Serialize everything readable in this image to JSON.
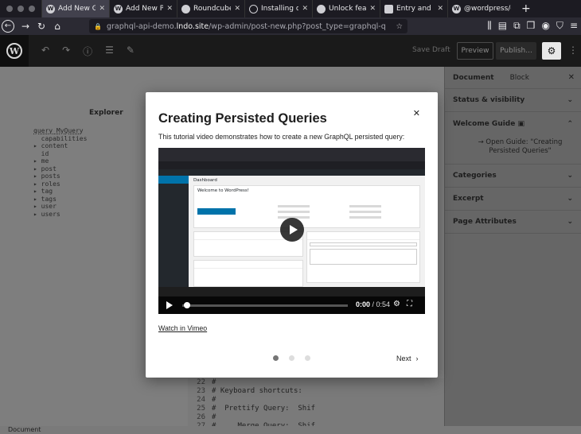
{
  "browser": {
    "tabs": [
      {
        "label": "Add New Graph",
        "icon": "wordpress-icon",
        "active": true
      },
      {
        "label": "Add New Post",
        "icon": "wordpress-icon",
        "active": false
      },
      {
        "label": "Roundcube We",
        "icon": "roundcube-icon",
        "active": false
      },
      {
        "label": "Installing on W",
        "icon": "loading-icon",
        "active": false
      },
      {
        "label": "Unlock feature",
        "icon": "github-icon",
        "active": false
      },
      {
        "label": "Entry and Cont",
        "icon": "page-icon",
        "active": false
      },
      {
        "label": "@wordpress/co",
        "icon": "wordpress-icon",
        "active": false
      }
    ],
    "url_prefix": "graphql-api-demo.",
    "url_domain": "lndo.site",
    "url_path": "/wp-admin/post-new.php?post_type=graphql-q",
    "new_tab": "+",
    "close_glyph": "✕"
  },
  "wp_header": {
    "save_draft": "Save Draft",
    "preview": "Preview",
    "publish": "Publish..."
  },
  "editor": {
    "explorer_title": "Explorer",
    "query_line": "query MyQuery",
    "fields": [
      "capabilities",
      "content",
      "id",
      "me",
      "post",
      "posts",
      "roles",
      "tag",
      "tags",
      "user",
      "users"
    ],
    "code_lines": [
      {
        "num": "22",
        "text": "#"
      },
      {
        "num": "23",
        "text": "# Keyboard shortcuts:"
      },
      {
        "num": "24",
        "text": "#"
      },
      {
        "num": "25",
        "text": "#  Prettify Query:  Shif"
      },
      {
        "num": "26",
        "text": "#"
      },
      {
        "num": "27",
        "text": "#     Merge Query:  Shif"
      }
    ]
  },
  "sidebar": {
    "tab_document": "Document",
    "tab_block": "Block",
    "panels": {
      "status": "Status & visibility",
      "welcome": "Welcome Guide",
      "guide_link": "→ Open Guide: \"Creating Persisted Queries\"",
      "categories": "Categories",
      "excerpt": "Excerpt",
      "page_attributes": "Page Attributes"
    }
  },
  "status_bar": "Document",
  "modal": {
    "title": "Creating Persisted Queries",
    "description": "This tutorial video demonstrates how to create a new GraphQL persisted query:",
    "video": {
      "time_current": "0:00",
      "time_total": "0:54",
      "progress": 0.0,
      "dashboard_title": "Dashboard",
      "welcome_title": "Welcome to WordPress!"
    },
    "watch_link": "Watch in Vimeo",
    "pages_total": 3,
    "page_current": 1,
    "next": "Next"
  },
  "colors": {
    "modal_bg": "#ffffff",
    "overlay_dim": "#7e7e7e",
    "wp_blue": "#0073aa"
  }
}
